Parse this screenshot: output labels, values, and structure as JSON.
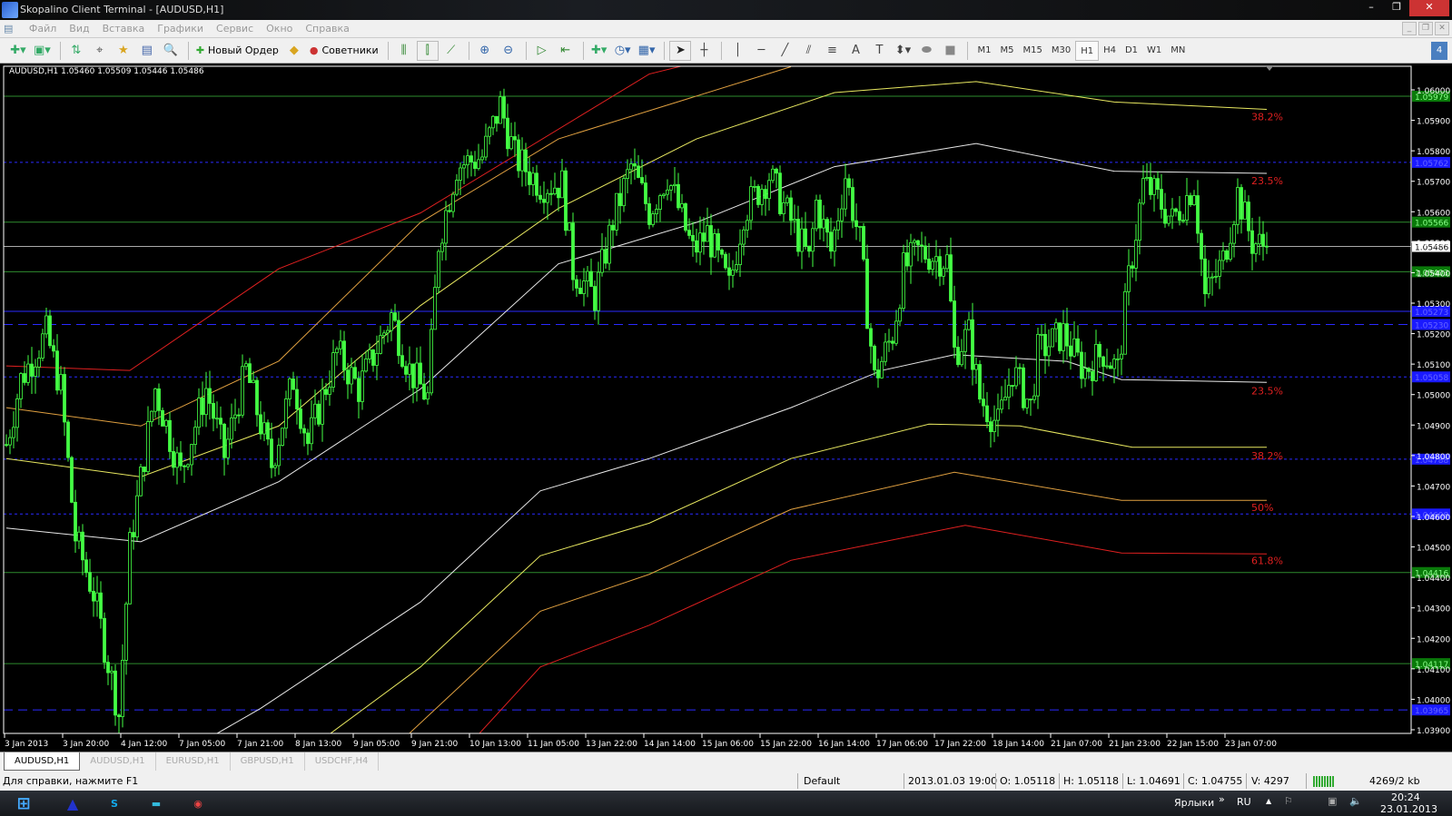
{
  "window": {
    "title": "Skopalino Client Terminal - [AUDUSD,H1]"
  },
  "menu": [
    "Файл",
    "Вид",
    "Вставка",
    "Графики",
    "Сервис",
    "Окно",
    "Справка"
  ],
  "toolbar": {
    "new_order": "Новый Ордер",
    "experts": "Советники",
    "timeframes": [
      "M1",
      "M5",
      "M15",
      "M30",
      "H1",
      "H4",
      "D1",
      "W1",
      "MN"
    ],
    "active_timeframe": "H1",
    "text_tool": "A",
    "alerts_badge": "4"
  },
  "chart": {
    "ohlc_header": "AUDUSD,H1  1.05460 1.05509 1.05446 1.05486"
  },
  "chart_data": {
    "type": "candlestick",
    "symbol": "AUDUSD",
    "timeframe": "H1",
    "ylim": [
      1.0383,
      1.06076
    ],
    "yticks": [
      "1.06000",
      "1.05900",
      "1.05800",
      "1.05700",
      "1.05600",
      "1.05500",
      "1.05400",
      "1.05300",
      "1.05200",
      "1.05100",
      "1.05000",
      "1.04900",
      "1.04800",
      "1.04700",
      "1.04600",
      "1.04500",
      "1.04400",
      "1.04300",
      "1.04200",
      "1.04100",
      "1.04000",
      "1.03900"
    ],
    "xticks": [
      "3 Jan 2013",
      "3 Jan 20:00",
      "4 Jan 12:00",
      "7 Jan 05:00",
      "7 Jan 21:00",
      "8 Jan 13:00",
      "9 Jan 05:00",
      "9 Jan 21:00",
      "10 Jan 13:00",
      "11 Jan 05:00",
      "13 Jan 22:00",
      "14 Jan 14:00",
      "15 Jan 06:00",
      "15 Jan 22:00",
      "16 Jan 14:00",
      "17 Jan 06:00",
      "17 Jan 22:00",
      "18 Jan 14:00",
      "21 Jan 07:00",
      "21 Jan 23:00",
      "22 Jan 15:00",
      "23 Jan 07:00"
    ],
    "bars_per_xtick": 16,
    "price_path": [
      [
        0,
        1.04836
      ],
      [
        4,
        1.0505
      ],
      [
        11,
        1.052
      ],
      [
        15,
        1.0502
      ],
      [
        19,
        1.0453
      ],
      [
        24,
        1.0435
      ],
      [
        31,
        1.0395
      ],
      [
        34,
        1.045
      ],
      [
        41,
        1.0502
      ],
      [
        48,
        1.0474
      ],
      [
        55,
        1.0502
      ],
      [
        60,
        1.048
      ],
      [
        66,
        1.0508
      ],
      [
        73,
        1.0477
      ],
      [
        79,
        1.0505
      ],
      [
        83,
        1.0484
      ],
      [
        91,
        1.0514
      ],
      [
        97,
        1.0502
      ],
      [
        106,
        1.0526
      ],
      [
        111,
        1.0508
      ],
      [
        116,
        1.0499
      ],
      [
        119,
        1.055
      ],
      [
        124,
        1.0575
      ],
      [
        131,
        1.0578
      ],
      [
        136,
        1.0595
      ],
      [
        140,
        1.0578
      ],
      [
        147,
        1.0569
      ],
      [
        153,
        1.0569
      ],
      [
        156,
        1.0541
      ],
      [
        162,
        1.0532
      ],
      [
        167,
        1.0557
      ],
      [
        172,
        1.0575
      ],
      [
        177,
        1.056
      ],
      [
        182,
        1.0572
      ],
      [
        189,
        1.0547
      ],
      [
        193,
        1.0553
      ],
      [
        199,
        1.0535
      ],
      [
        203,
        1.056
      ],
      [
        210,
        1.0572
      ],
      [
        216,
        1.0557
      ],
      [
        221,
        1.0544
      ],
      [
        223,
        1.0563
      ],
      [
        227,
        1.0547
      ],
      [
        231,
        1.0572
      ],
      [
        235,
        1.055
      ],
      [
        239,
        1.0505
      ],
      [
        244,
        1.052
      ],
      [
        247,
        1.0541
      ],
      [
        251,
        1.0547
      ],
      [
        259,
        1.0544
      ],
      [
        261,
        1.0514
      ],
      [
        265,
        1.052
      ],
      [
        268,
        1.0499
      ],
      [
        273,
        1.049
      ],
      [
        277,
        1.0508
      ],
      [
        282,
        1.0496
      ],
      [
        284,
        1.0514
      ],
      [
        291,
        1.052
      ],
      [
        295,
        1.0511
      ],
      [
        297,
        1.0508
      ],
      [
        302,
        1.0514
      ],
      [
        306,
        1.0508
      ],
      [
        309,
        1.0538
      ],
      [
        313,
        1.0569
      ],
      [
        316,
        1.0566
      ],
      [
        321,
        1.0557
      ],
      [
        327,
        1.0569
      ],
      [
        330,
        1.0532
      ],
      [
        335,
        1.0544
      ],
      [
        339,
        1.0566
      ],
      [
        343,
        1.055
      ],
      [
        347,
        1.05486
      ]
    ],
    "bands": [
      {
        "name": "upper-red",
        "color": "#e02020",
        "points": [
          [
            0,
            1.05094
          ],
          [
            34,
            1.05079
          ],
          [
            75,
            1.05413
          ],
          [
            114,
            1.05596
          ],
          [
            177,
            1.06052
          ],
          [
            190,
            1.0609
          ]
        ]
      },
      {
        "name": "upper-orange",
        "color": "#e0a040",
        "points": [
          [
            0,
            1.04957
          ],
          [
            37,
            1.04897
          ],
          [
            75,
            1.0511
          ],
          [
            114,
            1.05565
          ],
          [
            152,
            1.05839
          ],
          [
            216,
            1.06076
          ]
        ]
      },
      {
        "name": "upper-yellow",
        "color": "#e8e860",
        "points": [
          [
            0,
            1.0479
          ],
          [
            37,
            1.0473
          ],
          [
            75,
            1.04897
          ],
          [
            114,
            1.05292
          ],
          [
            152,
            1.05611
          ],
          [
            190,
            1.05839
          ],
          [
            228,
            1.05991
          ],
          [
            267,
            1.06027
          ],
          [
            305,
            1.0596
          ],
          [
            347,
            1.05936
          ]
        ]
      },
      {
        "name": "upper-white",
        "color": "#e8e8e8",
        "points": [
          [
            0,
            1.04562
          ],
          [
            37,
            1.04517
          ],
          [
            75,
            1.04714
          ],
          [
            114,
            1.05018
          ],
          [
            152,
            1.05429
          ],
          [
            190,
            1.05565
          ],
          [
            228,
            1.05748
          ],
          [
            267,
            1.05824
          ],
          [
            305,
            1.05733
          ],
          [
            347,
            1.05726
          ]
        ]
      },
      {
        "name": "lower-white",
        "color": "#e8e8e8",
        "points": [
          [
            50,
            1.03833
          ],
          [
            70,
            1.0397
          ],
          [
            114,
            1.04319
          ],
          [
            147,
            1.04684
          ],
          [
            177,
            1.0479
          ],
          [
            216,
            1.04957
          ],
          [
            241,
            1.05079
          ],
          [
            261,
            1.05131
          ],
          [
            292,
            1.05109
          ],
          [
            307,
            1.05049
          ],
          [
            347,
            1.0504
          ]
        ]
      },
      {
        "name": "lower-yellow",
        "color": "#e8e860",
        "points": [
          [
            83,
            1.03833
          ],
          [
            114,
            1.04106
          ],
          [
            147,
            1.04471
          ],
          [
            177,
            1.04578
          ],
          [
            216,
            1.0479
          ],
          [
            254,
            1.04903
          ],
          [
            279,
            1.04897
          ],
          [
            310,
            1.04827
          ],
          [
            347,
            1.04827
          ]
        ]
      },
      {
        "name": "lower-orange",
        "color": "#e0a040",
        "points": [
          [
            106,
            1.03833
          ],
          [
            147,
            1.04289
          ],
          [
            177,
            1.0441
          ],
          [
            216,
            1.04623
          ],
          [
            261,
            1.04745
          ],
          [
            307,
            1.04653
          ],
          [
            347,
            1.04653
          ]
        ]
      },
      {
        "name": "lower-red",
        "color": "#e02020",
        "points": [
          [
            126,
            1.03833
          ],
          [
            147,
            1.04106
          ],
          [
            177,
            1.04243
          ],
          [
            216,
            1.04456
          ],
          [
            264,
            1.04571
          ],
          [
            307,
            1.0448
          ],
          [
            347,
            1.04477
          ]
        ]
      }
    ],
    "levels": [
      {
        "price": "1.05979",
        "style": "solid",
        "color": "#2e8b2e"
      },
      {
        "price": "1.05762",
        "style": "dotted",
        "color": "#2a2aff"
      },
      {
        "price": "1.05566",
        "style": "solid",
        "color": "#2e8b2e"
      },
      {
        "price": "1.05486",
        "style": "current",
        "color": "#aaaaaa"
      },
      {
        "price": "1.05403",
        "style": "solid",
        "color": "#2e8b2e"
      },
      {
        "price": "1.05273",
        "style": "solid",
        "color": "#2a2aff"
      },
      {
        "price": "1.05230",
        "style": "dashed",
        "color": "#2a2aff"
      },
      {
        "price": "1.05058",
        "style": "dotted",
        "color": "#2a2aff"
      },
      {
        "price": "1.04788",
        "style": "dotted",
        "color": "#2a2aff"
      },
      {
        "price": "1.04608",
        "style": "dotted",
        "color": "#2a2aff"
      },
      {
        "price": "1.04416",
        "style": "solid",
        "color": "#2e8b2e"
      },
      {
        "price": "1.04117",
        "style": "solid",
        "color": "#2e8b2e"
      },
      {
        "price": "1.03965",
        "style": "dashed",
        "color": "#2a2aff"
      }
    ],
    "fib_labels": [
      [
        "38.2%",
        1.05912
      ],
      [
        "23.5%",
        1.05702
      ],
      [
        "23.5%",
        1.05012
      ],
      [
        "38.2%",
        1.04799
      ],
      [
        "50%",
        1.04629
      ],
      [
        "61.8%",
        1.04456
      ]
    ]
  },
  "tabs": [
    "AUDUSD,H1",
    "AUDUSD,H1",
    "EURUSD,H1",
    "GBPUSD,H1",
    "USDCHF,H4"
  ],
  "status": {
    "help": "Для справки, нажмите F1",
    "profile": "Default",
    "datetime": "2013.01.03 19:00",
    "open": "O: 1.05118",
    "high": "H: 1.05118",
    "low": "L: 1.04691",
    "close": "C: 1.04755",
    "volume": "V: 4297",
    "traffic": "4269/2 kb"
  },
  "taskbar": {
    "shortcuts": "Ярлыки",
    "lang": "RU",
    "time": "20:24",
    "date": "23.01.2013"
  }
}
